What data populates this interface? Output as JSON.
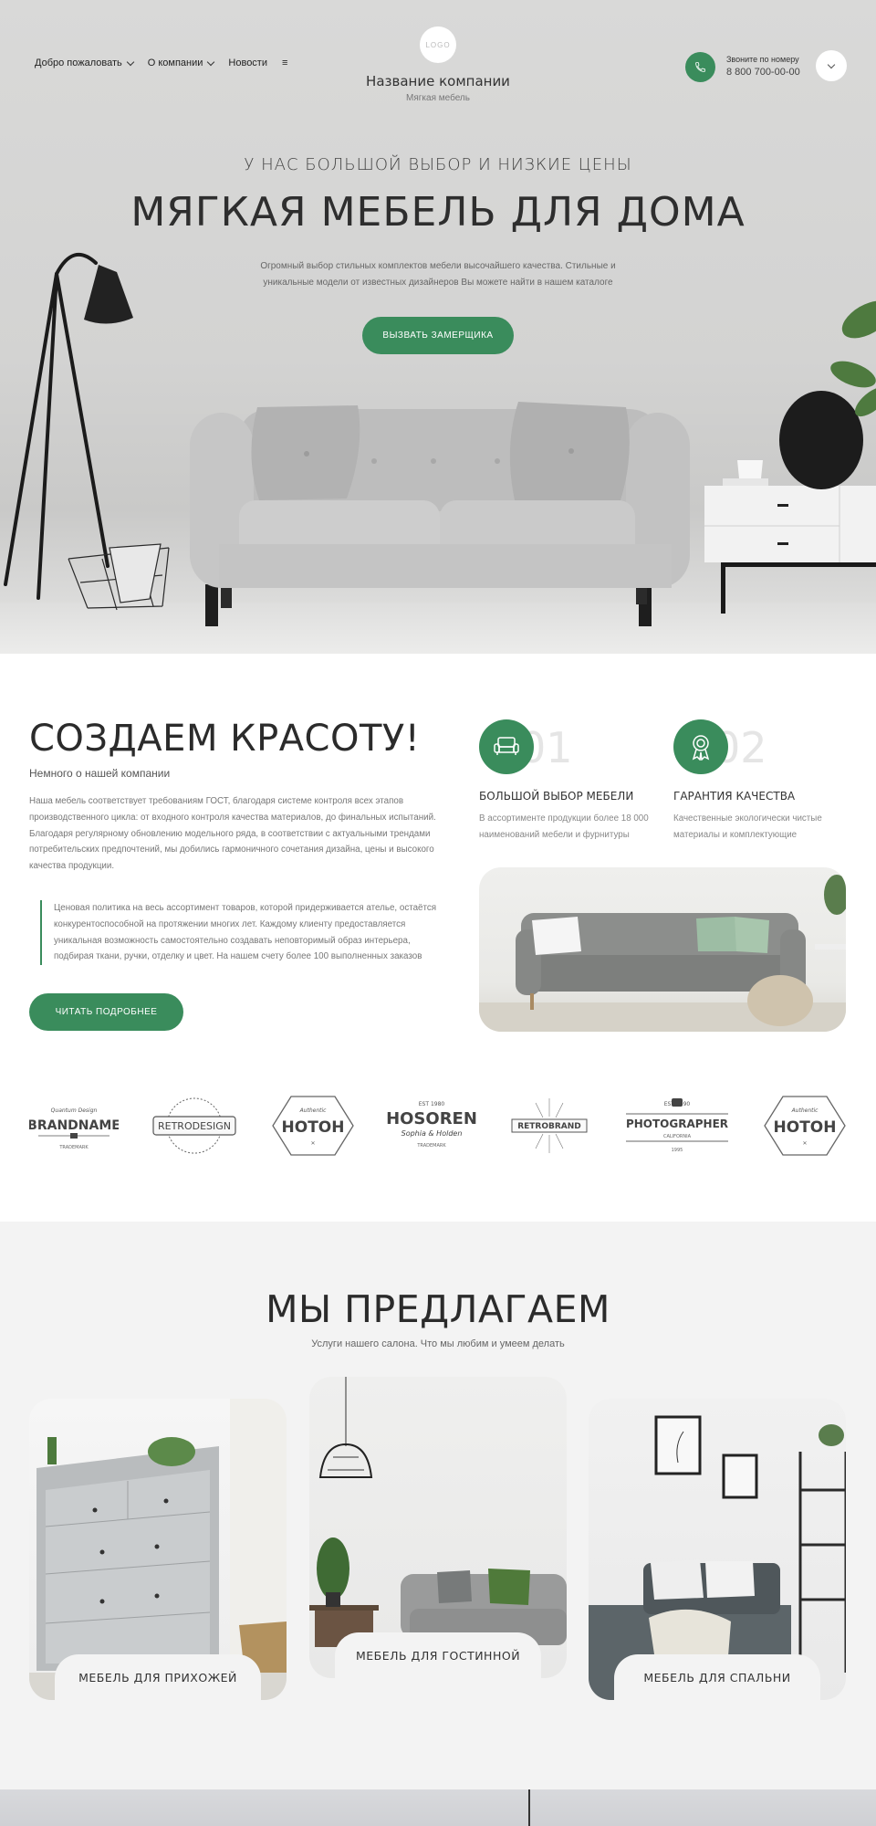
{
  "header": {
    "nav": [
      {
        "label": "Добро пожаловать",
        "has_dropdown": true
      },
      {
        "label": "О компании",
        "has_dropdown": true
      },
      {
        "label": "Новости",
        "has_dropdown": false
      }
    ],
    "menu_icon": "≡",
    "logo_text": "LOGO",
    "company_name": "Название компании",
    "company_sub": "Мягкая мебель",
    "phone_caption": "Звоните по номеру",
    "phone_number": "8 800 700-00-00"
  },
  "hero": {
    "kicker": "У НАС БОЛЬШОЙ ВЫБОР И НИЗКИЕ ЦЕНЫ",
    "title": "МЯГКАЯ МЕБЕЛЬ ДЛЯ ДОМА",
    "description": "Огромный выбор стильных комплектов мебели высочайшего качества. Стильные и уникальные модели от известных дизайнеров Вы можете найти в нашем каталоге",
    "cta": "ВЫЗВАТЬ ЗАМЕРЩИКА"
  },
  "about": {
    "title": "СОЗДАЕМ КРАСОТУ!",
    "subtitle": "Немного о нашей компании",
    "text": "Наша мебель соответствует требованиям ГОСТ, благодаря системе контроля всех этапов производственного цикла: от входного контроля качества материалов, до финальных испытаний. Благодаря регулярному обновлению модельного ряда, в соответствии с актуальными трендами потребительских предпочтений, мы добились гармоничного сочетания дизайна, цены и высокого качества продукции.",
    "quote": "Ценовая политика на весь ассортимент товаров, которой придерживается ателье, остаётся конкурентоспособной на протяжении многих лет. Каждому клиенту предоставляется уникальная возможность самостоятельно создавать неповторимый образ интерьера, подбирая ткани, ручки, отделку и цвет. На нашем счету более 100 выполненных заказов",
    "cta": "ЧИТАТЬ ПОДРОБНЕЕ",
    "features": [
      {
        "num": "01",
        "icon": "sofa-icon",
        "title": "БОЛЬШОЙ ВЫБОР МЕБЕЛИ",
        "desc": "В ассортименте продукции более 18 000 наименований мебели и фурнитуры"
      },
      {
        "num": "02",
        "icon": "award-ribbon-icon",
        "title": "ГАРАНТИЯ КАЧЕСТВА",
        "desc": "Качественные экологически чистые материалы и комплектующие"
      }
    ]
  },
  "brands": {
    "b1": {
      "top": "Quantum Design",
      "main": "BRANDNAME",
      "bottom": "TRADEMARK"
    },
    "b2": {
      "main": "RETRODESIGN"
    },
    "b3": {
      "top": "Authentic",
      "main": "HOTOH"
    },
    "b4": {
      "top": "EST 1980",
      "main": "HOSOREN",
      "sub": "Sophia & Holden",
      "bottom": "TRADEMARK"
    },
    "b5": {
      "main": "RETROBRAND"
    },
    "b6": {
      "top": "EST 1990",
      "main": "PHOTOGRAPHER",
      "sub": "CALIFORNIA",
      "bottom": "1995"
    },
    "b7": {
      "top": "Authentic",
      "main": "HOTOH"
    }
  },
  "services": {
    "title": "МЫ ПРЕДЛАГАЕМ",
    "subtitle": "Услуги нашего салона. Что мы любим и умеем делать",
    "cards": [
      {
        "label": "МЕБЕЛЬ ДЛЯ ПРИХОЖЕЙ"
      },
      {
        "label": "МЕБЕЛЬ ДЛЯ ГОСТИННОЙ"
      },
      {
        "label": "МЕБЕЛЬ ДЛЯ СПАЛЬНИ"
      }
    ]
  },
  "colors": {
    "accent": "#3a8c5c",
    "services_bg": "#f3f3f3"
  }
}
